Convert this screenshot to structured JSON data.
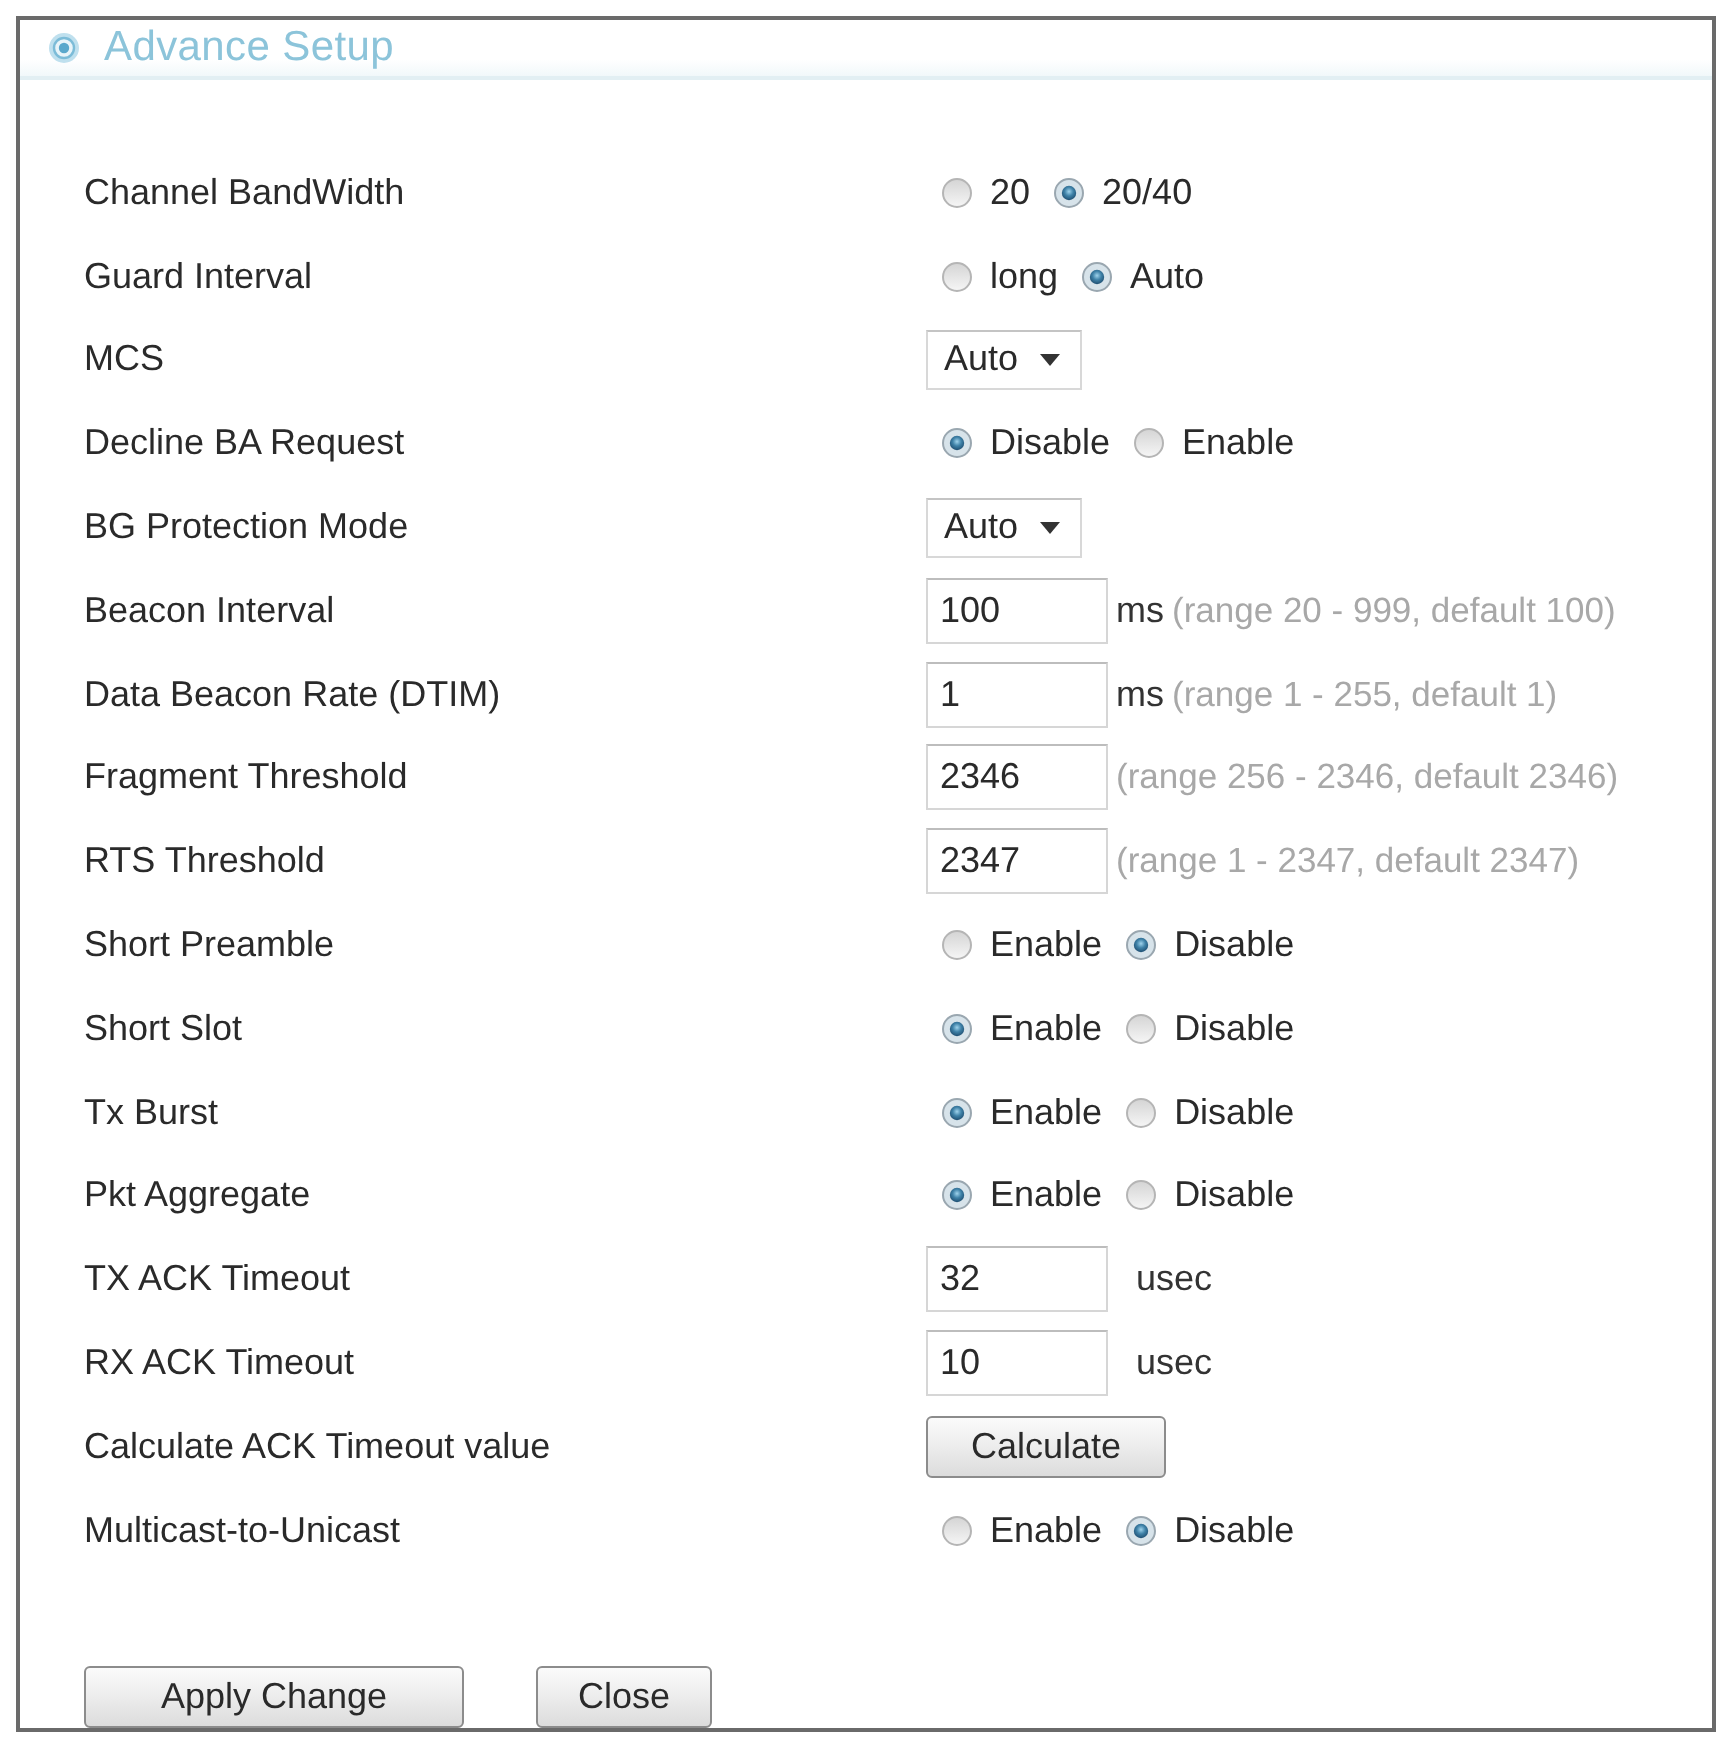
{
  "panel": {
    "title": "Advance Setup"
  },
  "settings": [
    {
      "kind": "radio",
      "label": "Channel BandWidth",
      "options": [
        {
          "label": "20",
          "selected": false
        },
        {
          "label": "20/40",
          "selected": true
        }
      ]
    },
    {
      "kind": "radio",
      "label": "Guard Interval",
      "options": [
        {
          "label": "long",
          "selected": false
        },
        {
          "label": "Auto",
          "selected": true
        }
      ]
    },
    {
      "kind": "select",
      "label": "MCS",
      "value": "Auto"
    },
    {
      "kind": "radio",
      "label": "Decline BA Request",
      "options": [
        {
          "label": "Disable",
          "selected": true
        },
        {
          "label": "Enable",
          "selected": false
        }
      ]
    },
    {
      "kind": "select",
      "label": "BG Protection Mode",
      "value": "Auto"
    },
    {
      "kind": "input",
      "label": "Beacon Interval",
      "value": "100",
      "unit": "ms",
      "hint": "(range 20 - 999, default 100)"
    },
    {
      "kind": "input",
      "label": "Data Beacon Rate (DTIM)",
      "value": "1",
      "unit": "ms",
      "hint": "(range 1 - 255, default 1)"
    },
    {
      "kind": "input",
      "label": "Fragment Threshold",
      "value": "2346",
      "hint": "(range 256 - 2346, default 2346)"
    },
    {
      "kind": "input",
      "label": "RTS Threshold",
      "value": "2347",
      "hint": "(range 1 - 2347, default 2347)"
    },
    {
      "kind": "radio",
      "label": "Short Preamble",
      "options": [
        {
          "label": "Enable",
          "selected": false
        },
        {
          "label": "Disable",
          "selected": true
        }
      ]
    },
    {
      "kind": "radio",
      "label": "Short Slot",
      "options": [
        {
          "label": "Enable",
          "selected": true
        },
        {
          "label": "Disable",
          "selected": false
        }
      ]
    },
    {
      "kind": "radio",
      "label": "Tx Burst",
      "options": [
        {
          "label": "Enable",
          "selected": true
        },
        {
          "label": "Disable",
          "selected": false
        }
      ]
    },
    {
      "kind": "radio",
      "label": "Pkt Aggregate",
      "options": [
        {
          "label": "Enable",
          "selected": true
        },
        {
          "label": "Disable",
          "selected": false
        }
      ]
    },
    {
      "kind": "input",
      "label": "TX ACK Timeout",
      "value": "32",
      "unit": "usec"
    },
    {
      "kind": "input",
      "label": "RX ACK Timeout",
      "value": "10",
      "unit": "usec"
    },
    {
      "kind": "button",
      "label": "Calculate ACK Timeout value",
      "button": "Calculate"
    },
    {
      "kind": "radio",
      "label": "Multicast-to-Unicast",
      "options": [
        {
          "label": "Enable",
          "selected": false
        },
        {
          "label": "Disable",
          "selected": true
        }
      ]
    }
  ],
  "buttons": [
    {
      "label": "Apply Change"
    },
    {
      "label": "Close"
    }
  ]
}
